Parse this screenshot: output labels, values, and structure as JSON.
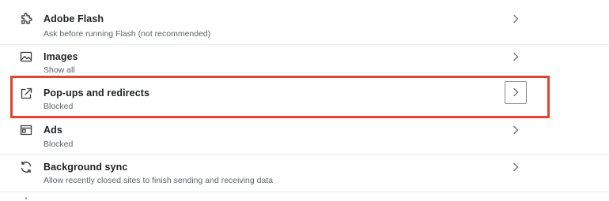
{
  "settings": {
    "items": [
      {
        "title": "Adobe Flash",
        "subtitle": "Ask before running Flash (not recommended)",
        "icon": "puzzle-piece-icon"
      },
      {
        "title": "Images",
        "subtitle": "Show all",
        "icon": "image-icon"
      },
      {
        "title": "Pop-ups and redirects",
        "subtitle": "Blocked",
        "icon": "open-in-new-icon",
        "highlighted": true
      },
      {
        "title": "Ads",
        "subtitle": "Blocked",
        "icon": "ad-window-icon"
      },
      {
        "title": "Background sync",
        "subtitle": "Allow recently closed sites to finish sending and receiving data",
        "icon": "sync-icon"
      }
    ]
  },
  "colors": {
    "highlight_border": "#e0432f",
    "title_text": "#202124",
    "subtitle_text": "#5f6368"
  }
}
